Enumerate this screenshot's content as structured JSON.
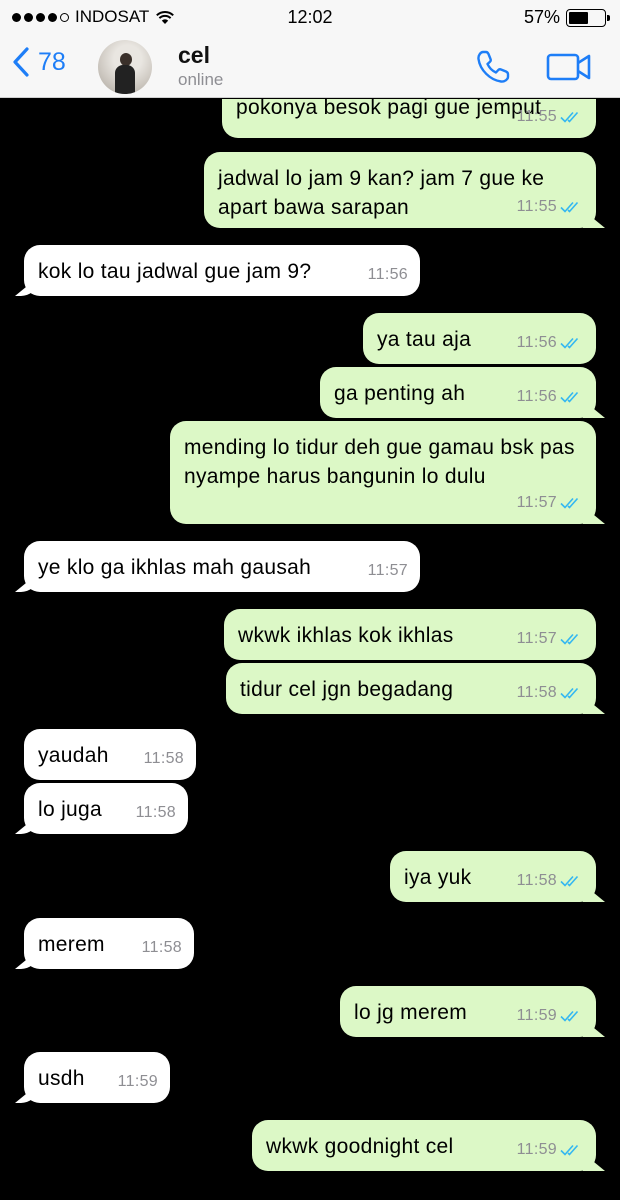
{
  "status_bar": {
    "carrier": "INDOSAT",
    "time": "12:02",
    "battery": "57%",
    "battery_level": 0.57
  },
  "header": {
    "back_count": "78",
    "contact_name": "cel",
    "contact_status": "online"
  },
  "messages": [
    {
      "dir": "out",
      "text": "pokonya besok pagi gue jemput",
      "time": "11:55"
    },
    {
      "dir": "out",
      "text": "jadwal lo jam 9 kan? jam 7 gue ke apart bawa sarapan",
      "time": "11:55"
    },
    {
      "dir": "in",
      "text": "kok lo tau jadwal gue jam 9?",
      "time": "11:56"
    },
    {
      "dir": "out",
      "text": "ya tau aja",
      "time": "11:56"
    },
    {
      "dir": "out",
      "text": "ga penting ah",
      "time": "11:56"
    },
    {
      "dir": "out",
      "text": "mending lo tidur deh gue gamau bsk pas nyampe harus bangunin lo dulu",
      "time": "11:57"
    },
    {
      "dir": "in",
      "text": "ye klo ga ikhlas mah gausah",
      "time": "11:57"
    },
    {
      "dir": "out",
      "text": "wkwk ikhlas kok ikhlas",
      "time": "11:57"
    },
    {
      "dir": "out",
      "text": "tidur cel jgn begadang",
      "time": "11:58"
    },
    {
      "dir": "in",
      "text": "yaudah",
      "time": "11:58"
    },
    {
      "dir": "in",
      "text": "lo juga",
      "time": "11:58"
    },
    {
      "dir": "out",
      "text": "iya yuk",
      "time": "11:58"
    },
    {
      "dir": "in",
      "text": "merem",
      "time": "11:58"
    },
    {
      "dir": "out",
      "text": "lo jg merem",
      "time": "11:59"
    },
    {
      "dir": "in",
      "text": "usdh",
      "time": "11:59"
    },
    {
      "dir": "out",
      "text": "wkwk goodnight cel",
      "time": "11:59"
    }
  ],
  "colors": {
    "accent": "#1e7ef7",
    "outgoing_bubble": "#dcf8c6",
    "incoming_bubble": "#ffffff",
    "background": "#000000",
    "read_ticks": "#34b7f1"
  }
}
